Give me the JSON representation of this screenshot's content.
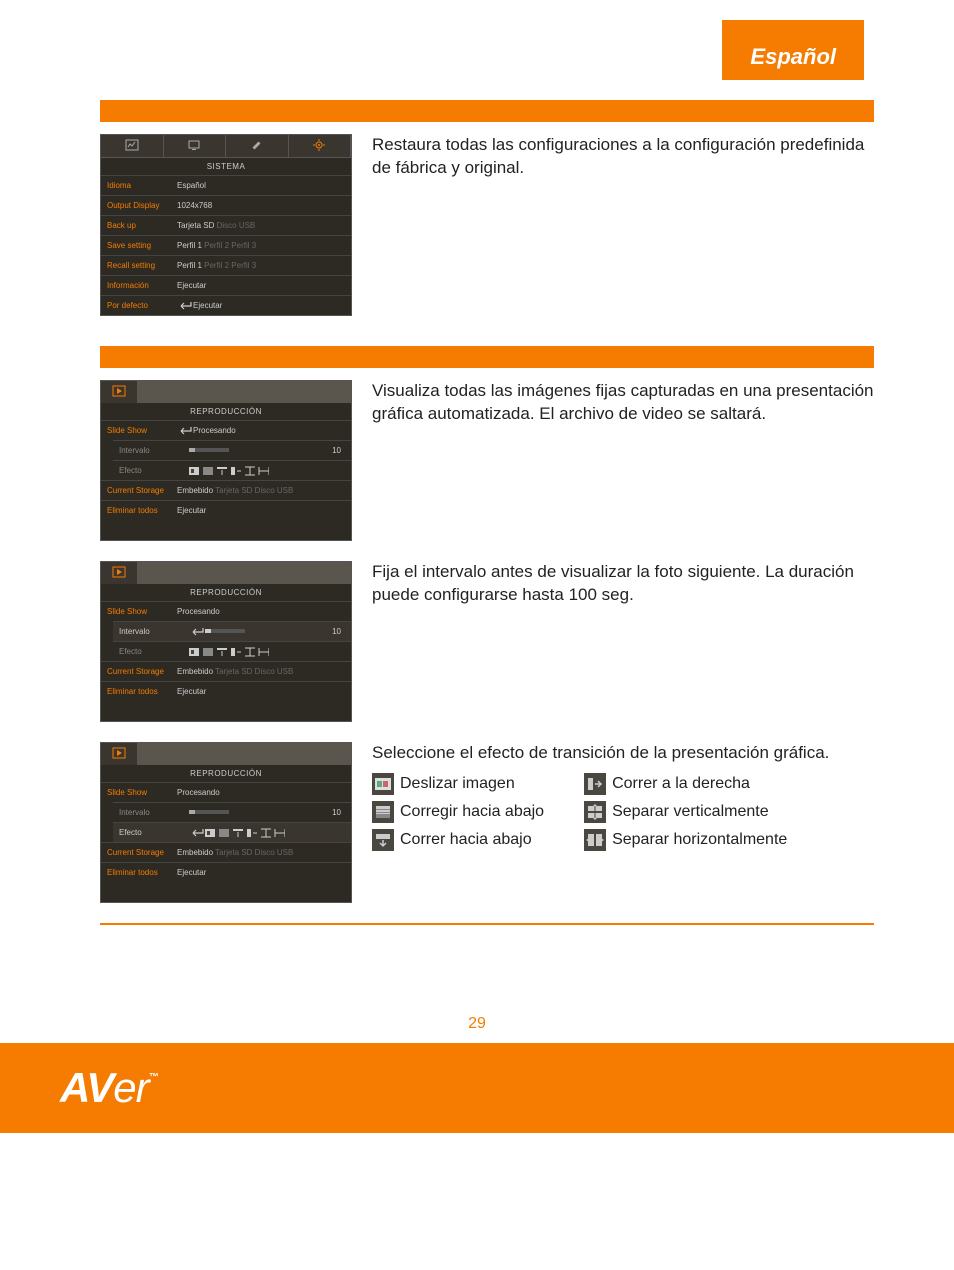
{
  "language_tab": "Español",
  "page_number": "29",
  "logo": "AVer",
  "logo_tm": "™",
  "section1": {
    "panel_title": "SISTEMA",
    "rows": {
      "idioma_label": "Idioma",
      "idioma_value": "Español",
      "output_label": "Output Display",
      "output_value": "1024x768",
      "backup_label": "Back up",
      "backup_value": "Tarjeta SD",
      "backup_dim": "Disco USB",
      "save_label": "Save setting",
      "save_p1": "Perfil 1",
      "save_p2": "Perfil 2",
      "save_p3": "Perfil 3",
      "recall_label": "Recall setting",
      "info_label": "Información",
      "ejecutar": "Ejecutar",
      "defecto_label": "Por defecto"
    },
    "description": "Restaura todas las configuraciones a la configuración predefinida de fábrica y original."
  },
  "section2": {
    "panel_title": "REPRODUCCIÓN",
    "rows": {
      "slideshow_label": "Slide Show",
      "procesando": "Procesando",
      "intervalo_label": "Intervalo",
      "intervalo_value": "10",
      "efecto_label": "Efecto",
      "storage_label": "Current Storage",
      "embebido": "Embebido",
      "storage_dim": "Tarjeta SD  Disco USB",
      "eliminar_label": "Eliminar todos",
      "ejecutar": "Ejecutar"
    },
    "row1_description": "Visualiza todas las imágenes fijas capturadas en una presentación gráfica automatizada. El archivo de video se saltará.",
    "row2_description": "Fija el intervalo antes de visualizar la foto siguiente. La duración puede configurarse hasta 100 seg.",
    "row3_description": "Seleccione el efecto de transición de la presentación gráfica.",
    "effects": {
      "e1": "Deslizar imagen",
      "e2": "Corregir hacia abajo",
      "e3": "Correr hacia abajo",
      "e4": "Correr a la derecha",
      "e5": "Separar verticalmente",
      "e6": "Separar horizontalmente"
    }
  }
}
